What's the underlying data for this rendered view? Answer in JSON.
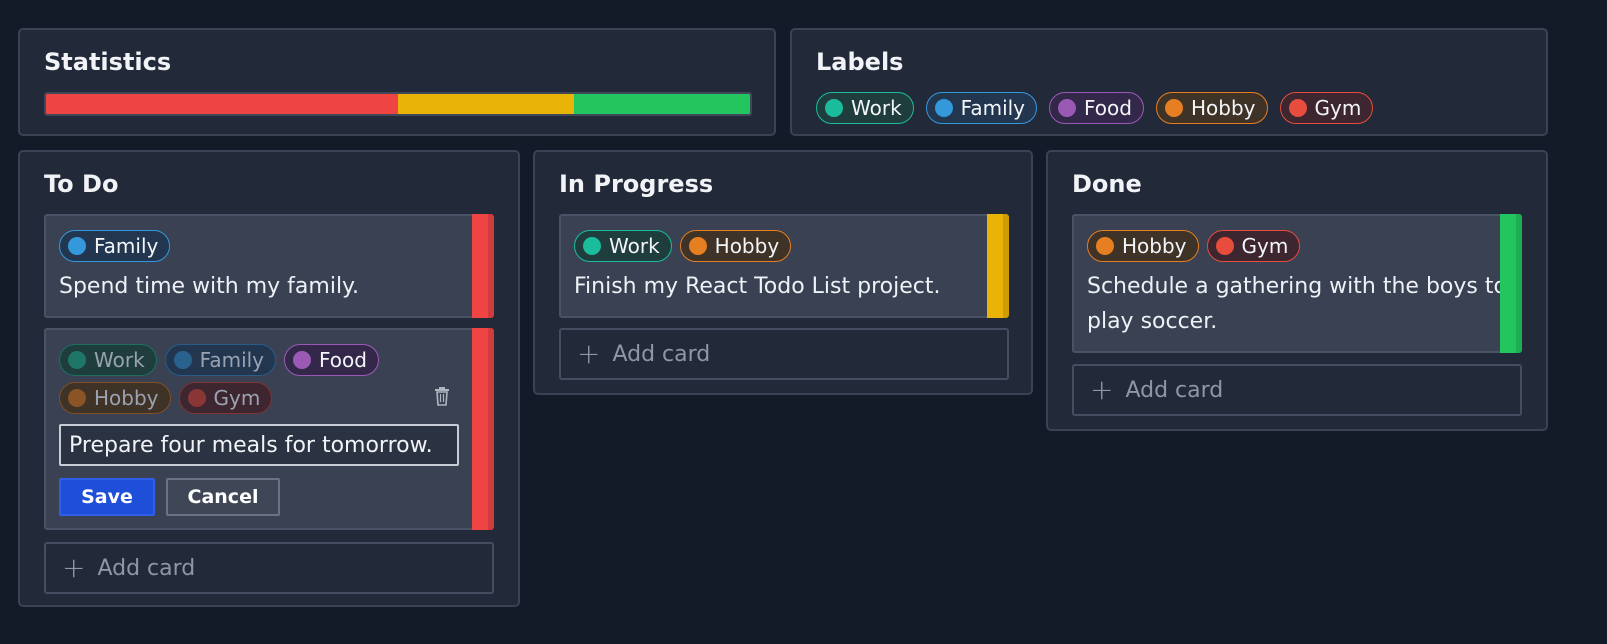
{
  "labels_catalog": [
    {
      "name": "Work",
      "dot": "#1abc9c",
      "border": "#1abc9c",
      "bg": "#1f3d3c"
    },
    {
      "name": "Family",
      "dot": "#3498db",
      "border": "#3498db",
      "bg": "#223650"
    },
    {
      "name": "Food",
      "dot": "#9b59b6",
      "border": "#9b59b6",
      "bg": "#34284a"
    },
    {
      "name": "Hobby",
      "dot": "#e67e22",
      "border": "#e67e22",
      "bg": "#3f3227"
    },
    {
      "name": "Gym",
      "dot": "#e74c3c",
      "border": "#e74c3c",
      "bg": "#3d2630"
    }
  ],
  "statistics": {
    "title": "Statistics",
    "segments": [
      {
        "status": "To Do",
        "fraction": 0.5,
        "color": "#ef4444"
      },
      {
        "status": "In Progress",
        "fraction": 0.25,
        "color": "#eab308"
      },
      {
        "status": "Done",
        "fraction": 0.25,
        "color": "#22c55e"
      }
    ]
  },
  "labels_panel": {
    "title": "Labels"
  },
  "columns": {
    "todo": {
      "title": "To Do",
      "color": "#ef4444",
      "card1": {
        "labels": [
          "Family"
        ],
        "text": "Spend time with my family."
      },
      "edit_card": {
        "labels_row1": [
          {
            "name": "Work",
            "selected": false
          },
          {
            "name": "Family",
            "selected": false
          },
          {
            "name": "Food",
            "selected": true
          }
        ],
        "labels_row2": [
          {
            "name": "Hobby",
            "selected": false
          },
          {
            "name": "Gym",
            "selected": false
          }
        ],
        "input_value": "Prepare four meals for tomorrow.",
        "save_label": "Save",
        "cancel_label": "Cancel",
        "delete_icon": "trash-icon"
      },
      "add_card_label": "Add card"
    },
    "in_progress": {
      "title": "In Progress",
      "color": "#eab308",
      "card1": {
        "labels": [
          "Work",
          "Hobby"
        ],
        "text": "Finish my React Todo List project."
      },
      "add_card_label": "Add card"
    },
    "done": {
      "title": "Done",
      "color": "#22c55e",
      "card1": {
        "labels": [
          "Hobby",
          "Gym"
        ],
        "text_line1": "Schedule a gathering with the boys to",
        "text_line2": "play soccer."
      },
      "add_card_label": "Add card"
    }
  }
}
